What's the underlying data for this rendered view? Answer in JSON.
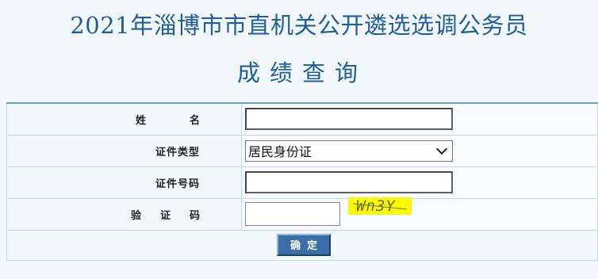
{
  "header": {
    "title": "2021年淄博市市直机关公开遴选选调公务员",
    "subtitle": "成绩查询"
  },
  "form": {
    "name_label": "姓名",
    "id_type_label": "证件类型",
    "id_type_value": "居民身份证",
    "id_number_label": "证件号码",
    "captcha_label": "验证码",
    "captcha_text": "Wn3Y",
    "submit_label": "确定"
  },
  "colors": {
    "title": "#1f5f99",
    "button": "#3b6ea8",
    "captcha_bg": "#fbfb00"
  }
}
